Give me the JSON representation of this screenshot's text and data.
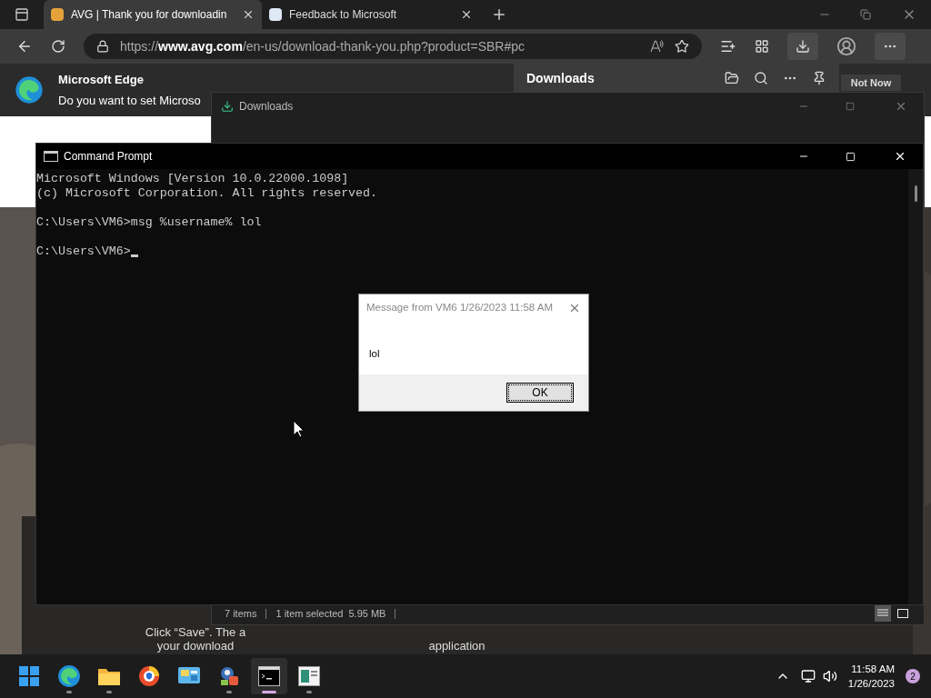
{
  "browser": {
    "tabs": [
      {
        "title": "AVG | Thank you for downloadin",
        "selected": true
      },
      {
        "title": "Feedback to Microsoft",
        "selected": false
      }
    ],
    "url": {
      "prefix": "https://",
      "domain": "www.avg.com",
      "path": "/en-us/download-thank-you.php?product=SBR#pc"
    },
    "infobar": {
      "title": "Microsoft Edge",
      "message": "Do you want to set Microso",
      "button": "Not Now"
    },
    "downloads_flyout": {
      "title": "Downloads"
    },
    "page_texts": [
      "Click “Save”. The a",
      "your download",
      "application"
    ]
  },
  "explorer_window": {
    "title": "Downloads",
    "status": [
      "7 items",
      "1 item selected",
      "5.95 MB"
    ]
  },
  "cmd_window": {
    "title": "Command Prompt",
    "cursor_visible": true,
    "blocks": [
      [
        "Microsoft Windows [Version 10.0.22000.1098]",
        "(c) Microsoft Corporation. All rights reserved."
      ],
      [
        "C:\\Users\\VM6>msg %username% lol"
      ],
      [
        "C:\\Users\\VM6>"
      ]
    ]
  },
  "message_box": {
    "title": "Message from VM6 1/26/2023 11:58 AM",
    "text": "lol",
    "button": "OK"
  },
  "taskbar": {
    "apps": [
      {
        "kind": "start",
        "running": false,
        "selected": false
      },
      {
        "kind": "edge",
        "running": true,
        "selected": false
      },
      {
        "kind": "folder",
        "running": true,
        "selected": false
      },
      {
        "kind": "shield",
        "running": false,
        "selected": false
      },
      {
        "kind": "panel",
        "running": false,
        "selected": false
      },
      {
        "kind": "avg",
        "running": true,
        "selected": false
      },
      {
        "kind": "cmd",
        "running": true,
        "selected": true
      },
      {
        "kind": "window",
        "running": true,
        "selected": false
      }
    ],
    "time": "11:58 AM",
    "date": "1/26/2023",
    "notifications": "2"
  }
}
